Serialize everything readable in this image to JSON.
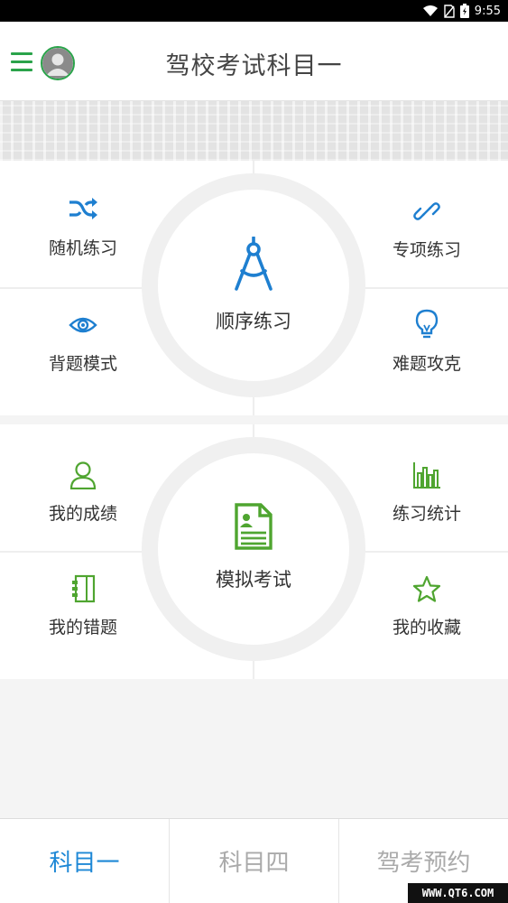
{
  "status_bar": {
    "time": "9:55",
    "icons": [
      "wifi-icon",
      "no-sim-icon",
      "battery-icon"
    ]
  },
  "header": {
    "title": "驾校考试科目一",
    "menu_icon": "hamburger-icon",
    "avatar_icon": "user-avatar-icon"
  },
  "colors": {
    "accent_green": "#2aa34a",
    "accent_blue": "#1e88d6",
    "practice_icon": "#1e7fd0",
    "exam_icon": "#4fa530"
  },
  "practice_panel": {
    "center_label": "顺序练习",
    "center_icon": "compass-icon",
    "items": [
      {
        "label": "随机练习",
        "icon": "shuffle-icon"
      },
      {
        "label": "专项练习",
        "icon": "link-icon"
      },
      {
        "label": "背题模式",
        "icon": "eye-icon"
      },
      {
        "label": "难题攻克",
        "icon": "lightbulb-icon"
      }
    ]
  },
  "exam_panel": {
    "center_label": "模拟考试",
    "center_icon": "exam-document-icon",
    "items": [
      {
        "label": "我的成绩",
        "icon": "user-icon"
      },
      {
        "label": "练习统计",
        "icon": "bar-chart-icon"
      },
      {
        "label": "我的错题",
        "icon": "notebook-icon"
      },
      {
        "label": "我的收藏",
        "icon": "star-icon"
      }
    ]
  },
  "tabs": [
    {
      "label": "科目一",
      "active": true
    },
    {
      "label": "科目四",
      "active": false
    },
    {
      "label": "驾考预约",
      "active": false
    }
  ],
  "watermark": "WWW.QT6.COM"
}
